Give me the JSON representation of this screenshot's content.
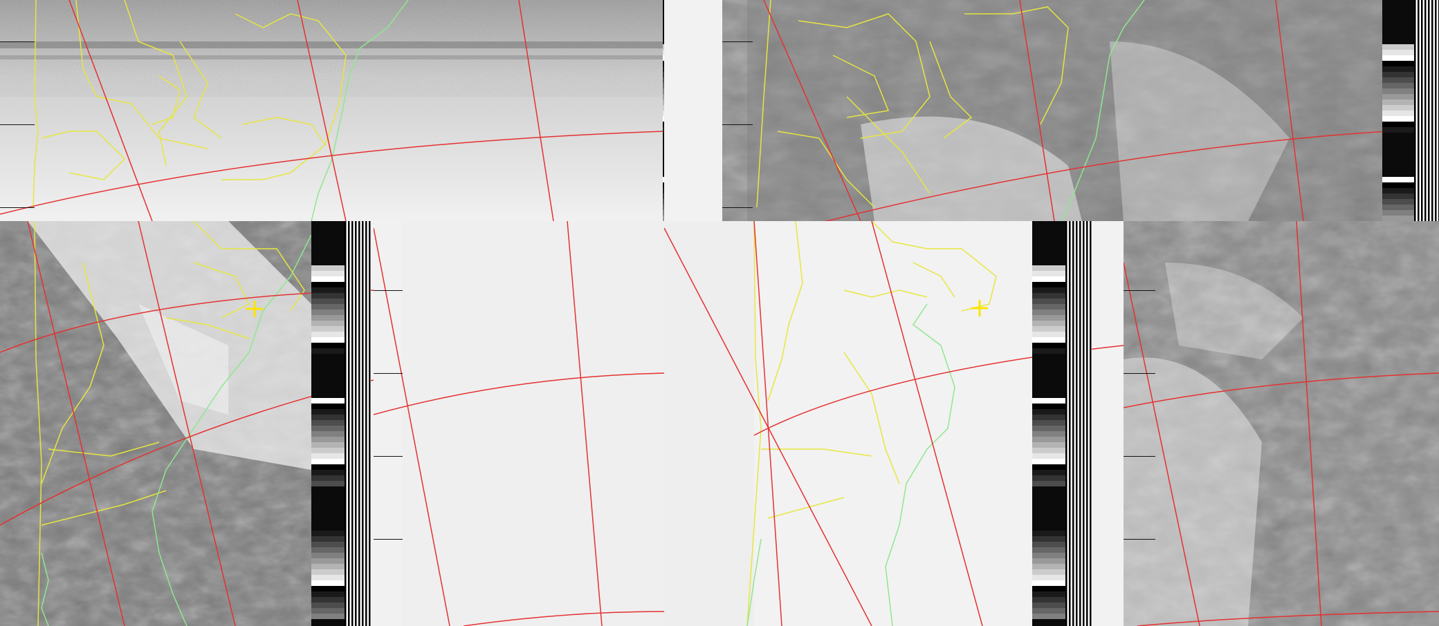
{
  "image": {
    "kind": "NOAA APT weather satellite image mosaic",
    "frames": [
      {
        "position": "top-left",
        "channel": "visible-like",
        "tone": "light"
      },
      {
        "position": "top-right",
        "channel": "infrared-like",
        "tone": "dark"
      },
      {
        "position": "bottom-left",
        "channel": "infrared-like",
        "tone": "dark",
        "has_center_marker": true
      },
      {
        "position": "bottom-middle",
        "channel": "visible-like",
        "tone": "light"
      },
      {
        "position": "bottom-middle-right",
        "channel": "visible-like",
        "tone": "light",
        "has_center_marker": true
      },
      {
        "position": "bottom-right",
        "channel": "infrared-like",
        "tone": "dark"
      }
    ],
    "overlay_colors": {
      "graticule": "#e53030",
      "borders": "#e6e640",
      "coastline": "#8ee88e",
      "marker": "#ffe400"
    },
    "telemetry_wedge_colors": [
      "#000000",
      "#1a1a1a",
      "#333333",
      "#4d4d4d",
      "#666666",
      "#808080",
      "#999999",
      "#b3b3b3",
      "#cccccc",
      "#e6e6e6",
      "#ffffff"
    ]
  }
}
